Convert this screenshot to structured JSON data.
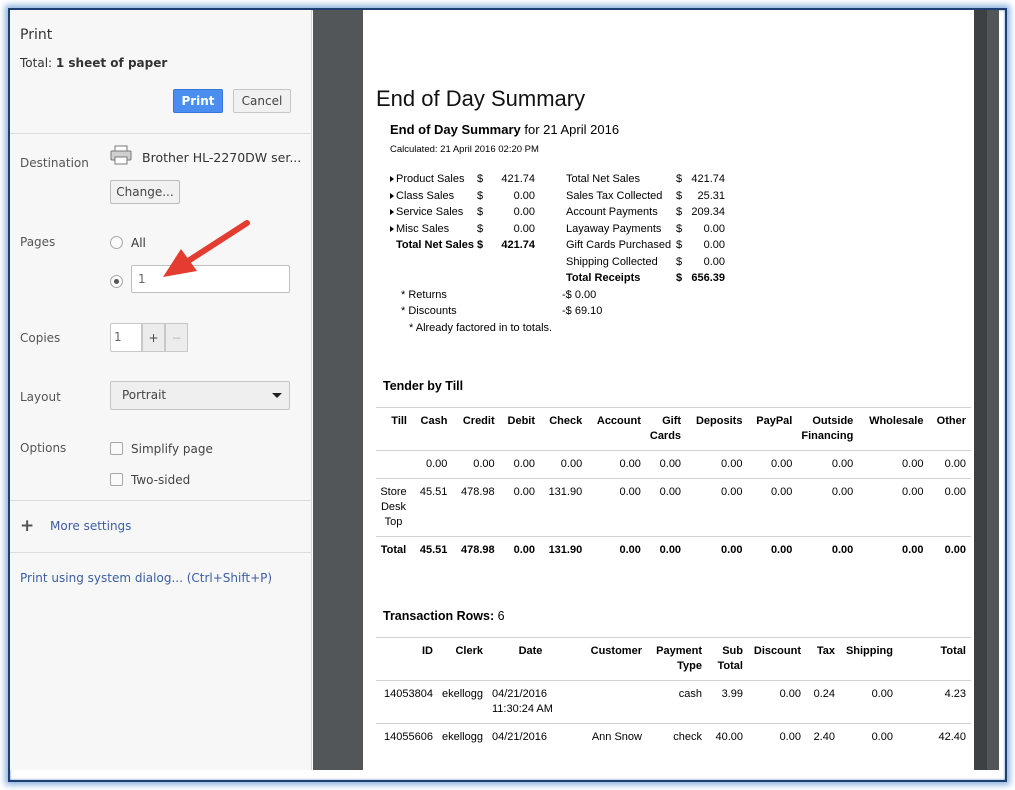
{
  "dialog": {
    "title": "Print",
    "total_prefix": "Total: ",
    "total_value": "1 sheet of paper",
    "print_label": "Print",
    "cancel_label": "Cancel"
  },
  "destination": {
    "label": "Destination",
    "printer_name": "Brother HL-2270DW ser...",
    "change_label": "Change..."
  },
  "pages": {
    "label": "Pages",
    "all_label": "All",
    "custom_value": "1",
    "selected": "custom"
  },
  "copies": {
    "label": "Copies",
    "value": "1",
    "plus": "+",
    "minus": "−"
  },
  "layout": {
    "label": "Layout",
    "value": "Portrait"
  },
  "options": {
    "label": "Options",
    "simplify_label": "Simplify page",
    "two_sided_label": "Two-sided"
  },
  "more_settings_label": "More settings",
  "system_dialog_label": "Print using system dialog... (Ctrl+Shift+P)",
  "annotation": {
    "color": "#e53c31",
    "icon": "red-arrow-icon"
  },
  "preview": {
    "heading": "End of Day Summary",
    "sub_bold": "End of Day Summary",
    "sub_rest": " for 21 April 2016",
    "calculated": "Calculated: 21 April 2016 02:20 PM",
    "left_rows": [
      {
        "label": "Product Sales",
        "cur": "$",
        "val": "421.74"
      },
      {
        "label": "Class Sales",
        "cur": "$",
        "val": "0.00"
      },
      {
        "label": "Service Sales",
        "cur": "$",
        "val": "0.00"
      },
      {
        "label": "Misc Sales",
        "cur": "$",
        "val": "0.00"
      },
      {
        "label": "Total Net Sales",
        "cur": "$",
        "val": "421.74"
      }
    ],
    "right_rows": [
      {
        "label": "Total Net Sales",
        "cur": "$",
        "val": "421.74"
      },
      {
        "label": "Sales Tax Collected",
        "cur": "$",
        "val": "25.31"
      },
      {
        "label": "Account Payments",
        "cur": "$",
        "val": "209.34"
      },
      {
        "label": "Layaway Payments",
        "cur": "$",
        "val": "0.00"
      },
      {
        "label": "Gift Cards Purchased",
        "cur": "$",
        "val": "0.00"
      },
      {
        "label": "Shipping Collected",
        "cur": "$",
        "val": "0.00"
      },
      {
        "label": "Total Receipts",
        "cur": "$",
        "val": "656.39"
      }
    ],
    "returns": {
      "label": "* Returns",
      "val": "-$ 0.00"
    },
    "discounts": {
      "label": "* Discounts",
      "val": "-$ 69.10"
    },
    "note": "* Already factored in to totals.",
    "tender_title": "Tender by Till",
    "tender_headers": [
      "Till",
      "Cash",
      "Credit",
      "Debit",
      "Check",
      "Account",
      "Gift Cards",
      "Deposits",
      "PayPal",
      "Outside Financing",
      "Wholesale",
      "Other"
    ],
    "tender_rows": [
      [
        "",
        "0.00",
        "0.00",
        "0.00",
        "0.00",
        "0.00",
        "0.00",
        "0.00",
        "0.00",
        "0.00",
        "0.00",
        "0.00"
      ],
      [
        "Store Desk Top",
        "45.51",
        "478.98",
        "0.00",
        "131.90",
        "0.00",
        "0.00",
        "0.00",
        "0.00",
        "0.00",
        "0.00",
        "0.00"
      ],
      [
        "Total",
        "45.51",
        "478.98",
        "0.00",
        "131.90",
        "0.00",
        "0.00",
        "0.00",
        "0.00",
        "0.00",
        "0.00",
        "0.00"
      ]
    ],
    "tx_title": "Transaction Rows:",
    "tx_count": "6",
    "tx_headers": [
      "ID",
      "Clerk",
      "Date",
      "Customer",
      "Payment Type",
      "Sub Total",
      "Discount",
      "Tax",
      "Shipping",
      "Total"
    ],
    "tx_rows": [
      [
        "14053804",
        "ekellogg",
        "04/21/2016 11:30:24 AM",
        "",
        "cash",
        "3.99",
        "0.00",
        "0.24",
        "0.00",
        "4.23"
      ],
      [
        "14055606",
        "ekellogg",
        "04/21/2016",
        "Ann Snow",
        "check",
        "40.00",
        "0.00",
        "2.40",
        "0.00",
        "42.40"
      ]
    ]
  }
}
